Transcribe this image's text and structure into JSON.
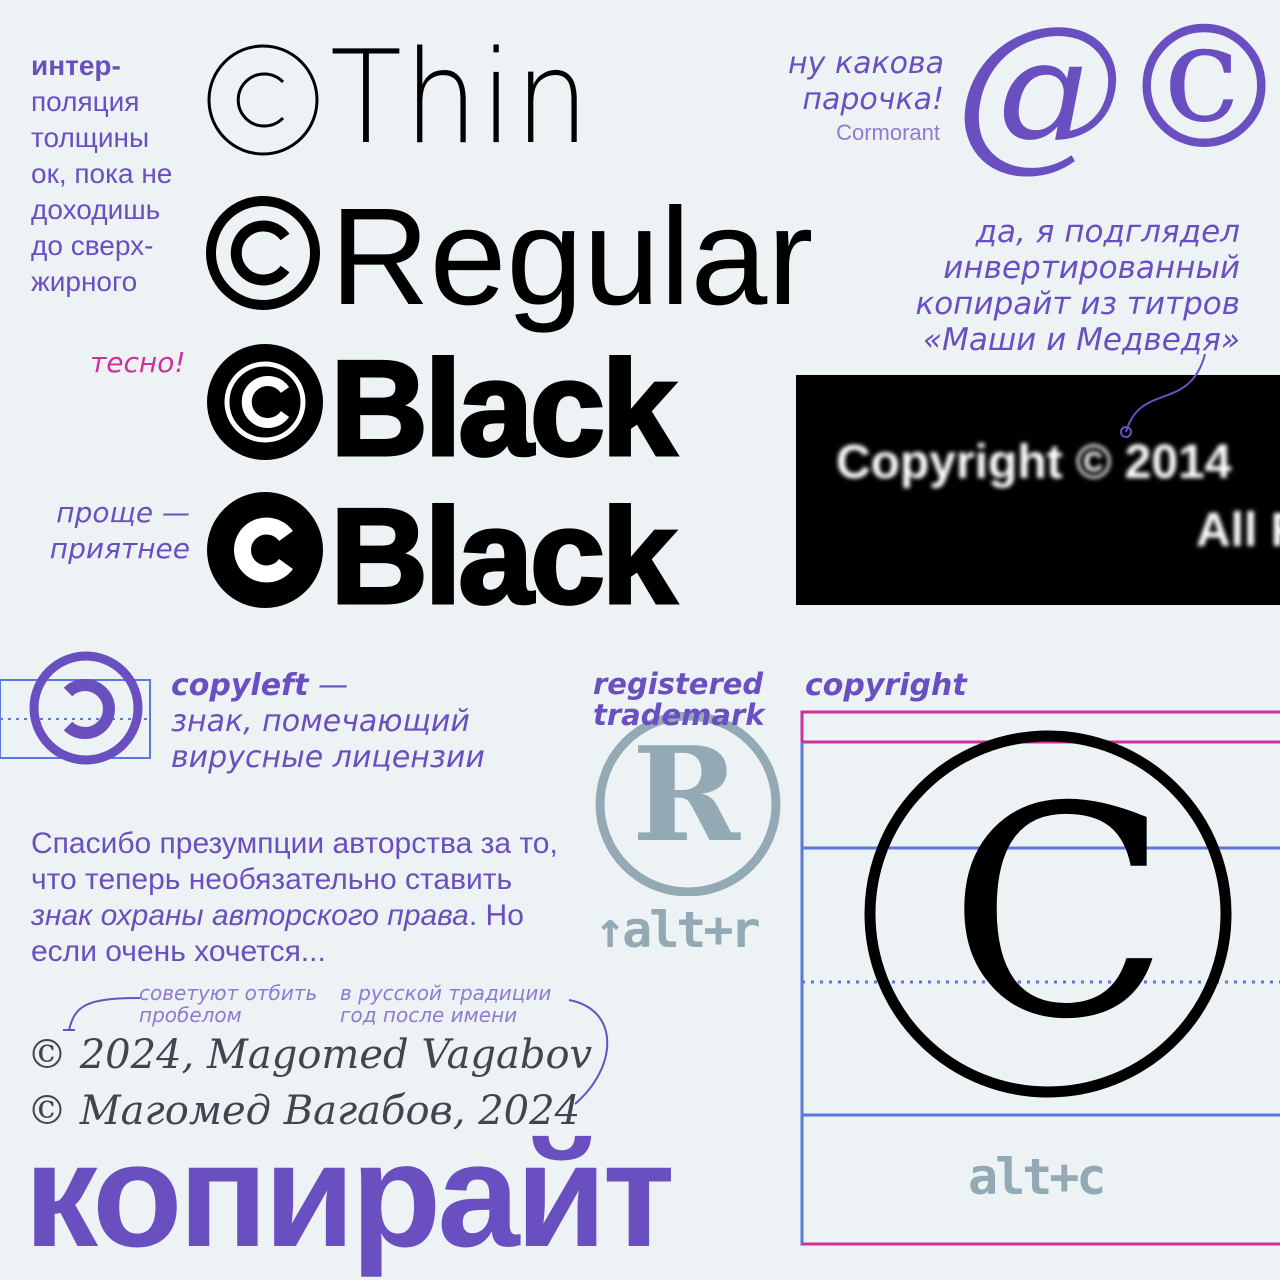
{
  "left_note": {
    "bold_line": "интер-",
    "lines": [
      "поляция",
      "толщины",
      "ок, пока не",
      "доходишь",
      "до сверх-",
      "жирного"
    ]
  },
  "weights": {
    "thin": "Thin",
    "regular": "Regular",
    "black1": "Black",
    "black2": "Black"
  },
  "notes": {
    "tight": "тесно!",
    "simpler": [
      "проще —",
      "приятнее"
    ],
    "pair": [
      "ну какова",
      "парочка!"
    ],
    "pair_font": "Cormorant",
    "peek": [
      "да, я подглядел",
      "инвертированный",
      "копирайт из титров",
      "«Маши и Медведя»"
    ],
    "spacing": [
      "советуют отбить",
      "пробелом"
    ],
    "russian": [
      "в русской традиции",
      "год после имени"
    ]
  },
  "pair_glyphs": "@©",
  "credits": {
    "line1": "Copyright © 2014",
    "line2": "All R"
  },
  "copyleft": {
    "term": "copyleft",
    "dash": " —",
    "lines": [
      "знак, помечающий",
      "вирусные лицензии"
    ]
  },
  "registered": {
    "label": [
      "registered",
      "trademark"
    ],
    "letter": "R",
    "shortcut": "↑alt+r"
  },
  "copyright": {
    "label": "copyright",
    "letter": "C",
    "shortcut": "alt+c"
  },
  "paragraph": {
    "part1": "Спасибо презумпции авторства за то, что теперь необязательно ставить ",
    "italic1": "знак охраны авторского права",
    "part2": ". Но если очень хочется..."
  },
  "examples": {
    "en": "© 2024, Magomed Vagabov",
    "ru": "© Магомед Вагабов, 2024"
  },
  "big_title": "копирайт",
  "colors": {
    "background": "#edf2f5",
    "violet": "#6a4fc1",
    "magenta": "#d0309e",
    "blue_guides": "#5b78e0",
    "grey_blue": "#93aab4",
    "black": "#000000"
  }
}
